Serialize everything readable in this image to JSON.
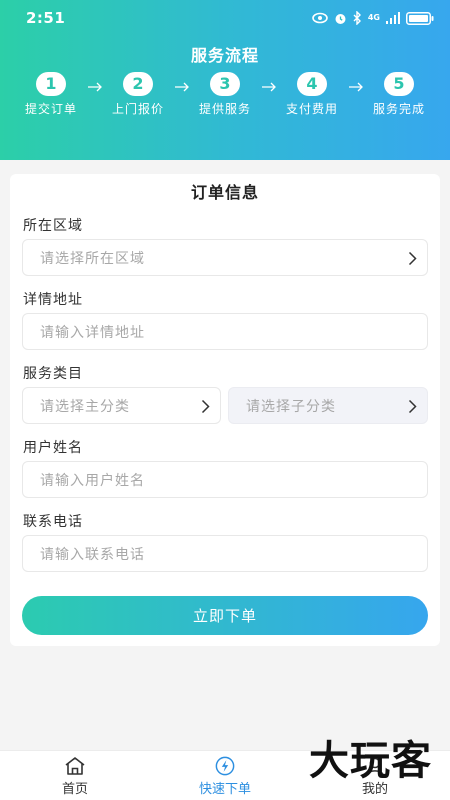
{
  "status_bar": {
    "time": "2:51",
    "network": "4G"
  },
  "header": {
    "title": "服务流程",
    "steps": [
      {
        "num": "1",
        "label": "提交订单"
      },
      {
        "num": "2",
        "label": "上门报价"
      },
      {
        "num": "3",
        "label": "提供服务"
      },
      {
        "num": "4",
        "label": "支付费用"
      },
      {
        "num": "5",
        "label": "服务完成"
      }
    ]
  },
  "form": {
    "title": "订单信息",
    "region": {
      "label": "所在区域",
      "placeholder": "请选择所在区域"
    },
    "address": {
      "label": "详情地址",
      "placeholder": "请输入详情地址"
    },
    "category": {
      "label": "服务类目",
      "main_placeholder": "请选择主分类",
      "sub_placeholder": "请选择子分类"
    },
    "username": {
      "label": "用户姓名",
      "placeholder": "请输入用户姓名"
    },
    "phone": {
      "label": "联系电话",
      "placeholder": "请输入联系电话"
    },
    "submit_label": "立即下单"
  },
  "tabbar": {
    "items": [
      {
        "label": "首页",
        "icon": "home-icon"
      },
      {
        "label": "快速下单",
        "icon": "lightning-icon",
        "active": true
      },
      {
        "label": "我的",
        "icon": "user-icon"
      }
    ]
  },
  "watermark": "大玩客",
  "colors": {
    "accent_start": "#2ccfa8",
    "accent_end": "#37a7ee",
    "tab_active": "#2d8fe0"
  }
}
